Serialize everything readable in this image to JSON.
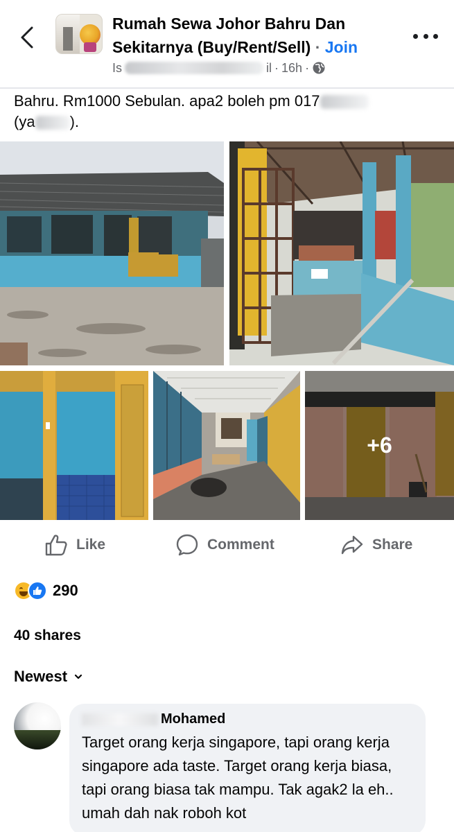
{
  "header": {
    "group_title": "Rumah Sewa Johor Bahru Dan Sekitarnya (Buy/Rent/Sell)",
    "separator": "·",
    "join_label": "Join",
    "author_partial_start": "Is",
    "author_partial_end": "il",
    "time": "16h",
    "meta_dot": "·",
    "icons": {
      "back": "chevron-left-icon",
      "privacy": "globe-icon",
      "more": "more-horizontal-icon"
    }
  },
  "post": {
    "text_line1": "Bahru. Rm1000 Sebulan. apa2 boleh pm 017",
    "text_line2": "(ya",
    "text_line2_end": ")."
  },
  "photos": {
    "more_count": "+6"
  },
  "actions": {
    "like": "Like",
    "comment": "Comment",
    "share": "Share"
  },
  "engagement": {
    "reaction_count": "290",
    "shares": "40 shares"
  },
  "comments": {
    "sort_label": "Newest",
    "items": [
      {
        "name_visible": "Mohamed",
        "text": "Target orang kerja singapore, tapi orang kerja singapore ada taste. Target orang kerja biasa, tapi orang biasa tak mampu. Tak agak2 la eh.. umah dah nak roboh kot"
      }
    ]
  },
  "colors": {
    "link_blue": "#1877f2",
    "secondary_text": "#65676b",
    "comment_bubble": "#f0f2f5"
  }
}
